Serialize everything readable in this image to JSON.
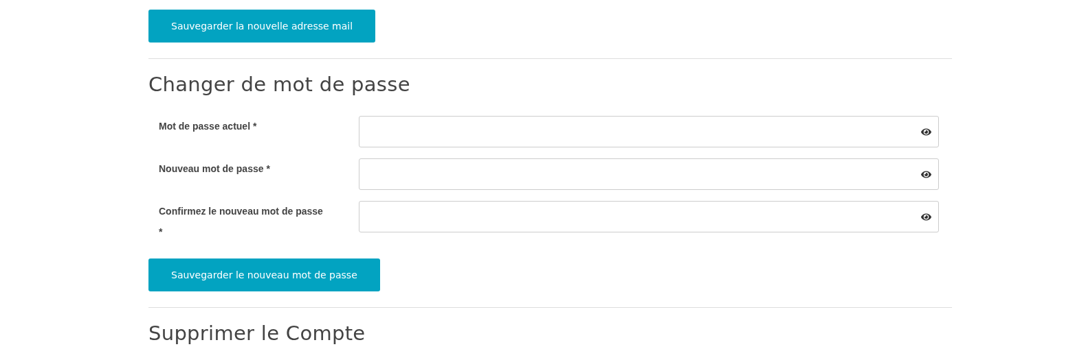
{
  "email_section": {
    "save_button": "Sauvegarder la nouvelle adresse mail"
  },
  "password_section": {
    "title": "Changer de mot de passe",
    "fields": [
      {
        "label": "Mot de passe actuel *"
      },
      {
        "label": "Nouveau mot de passe *"
      },
      {
        "label": "Confirmez le nouveau mot de passe *"
      }
    ],
    "save_button": "Sauvegarder le nouveau mot de passe"
  },
  "delete_section": {
    "title": "Supprimer le Compte"
  }
}
